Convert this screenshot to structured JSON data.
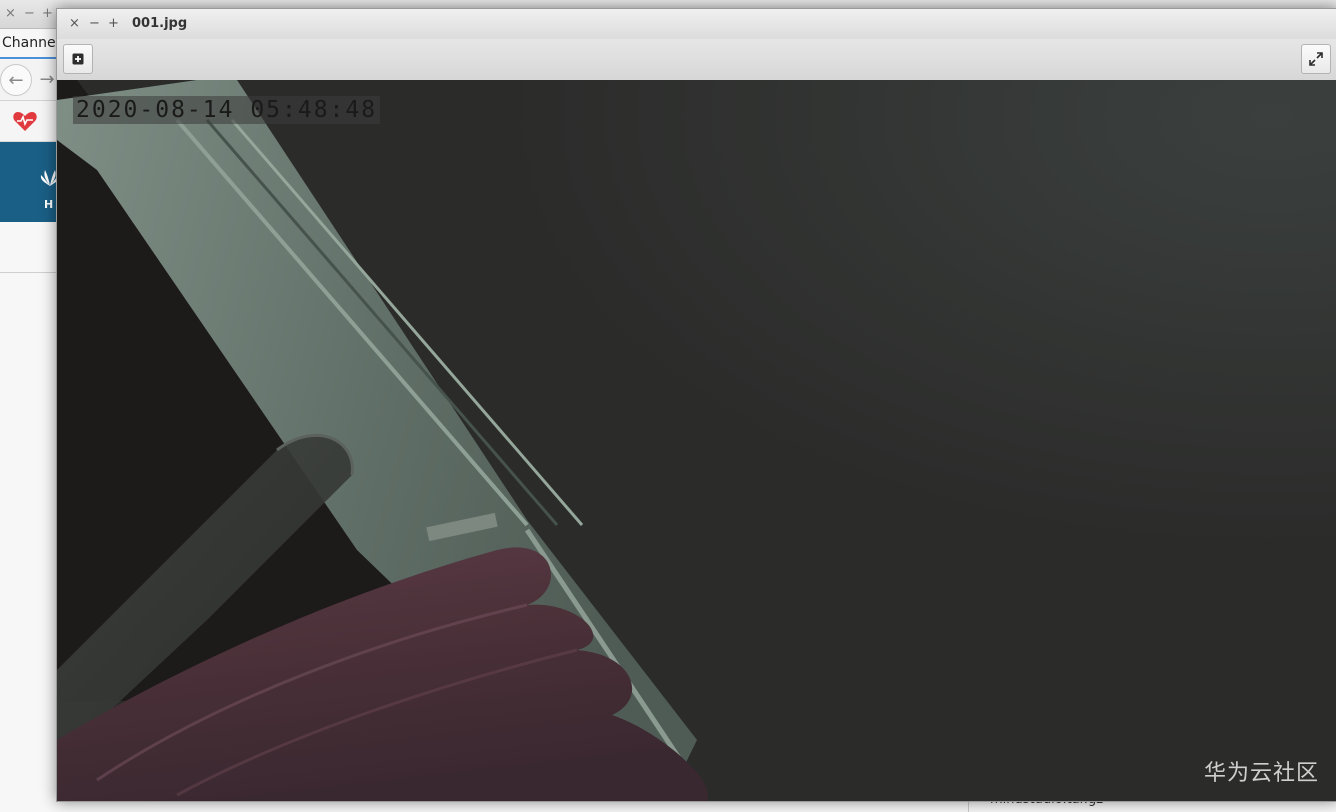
{
  "background_window": {
    "tab_label": "Channel",
    "window_controls": [
      "×",
      "−",
      "+"
    ],
    "nav": {
      "back_icon": "arrow-left-icon",
      "forward_icon": "arrow-right-icon"
    },
    "bookmark_icon": "heart-icon",
    "banner_logo_text": "H",
    "file_name": "mindstudio.tar.gz"
  },
  "viewer": {
    "title": "001.jpg",
    "window_controls": {
      "close": "×",
      "minimize": "−",
      "maximize": "+"
    },
    "toolbar": {
      "add_icon": "plus-square-icon",
      "fullscreen_icon": "expand-icon"
    },
    "image": {
      "timestamp": "2020-08-14 05:48:48",
      "watermark": "华为云社区"
    }
  },
  "colors": {
    "banner": "#1a5f86",
    "heart": "#e0393e"
  }
}
